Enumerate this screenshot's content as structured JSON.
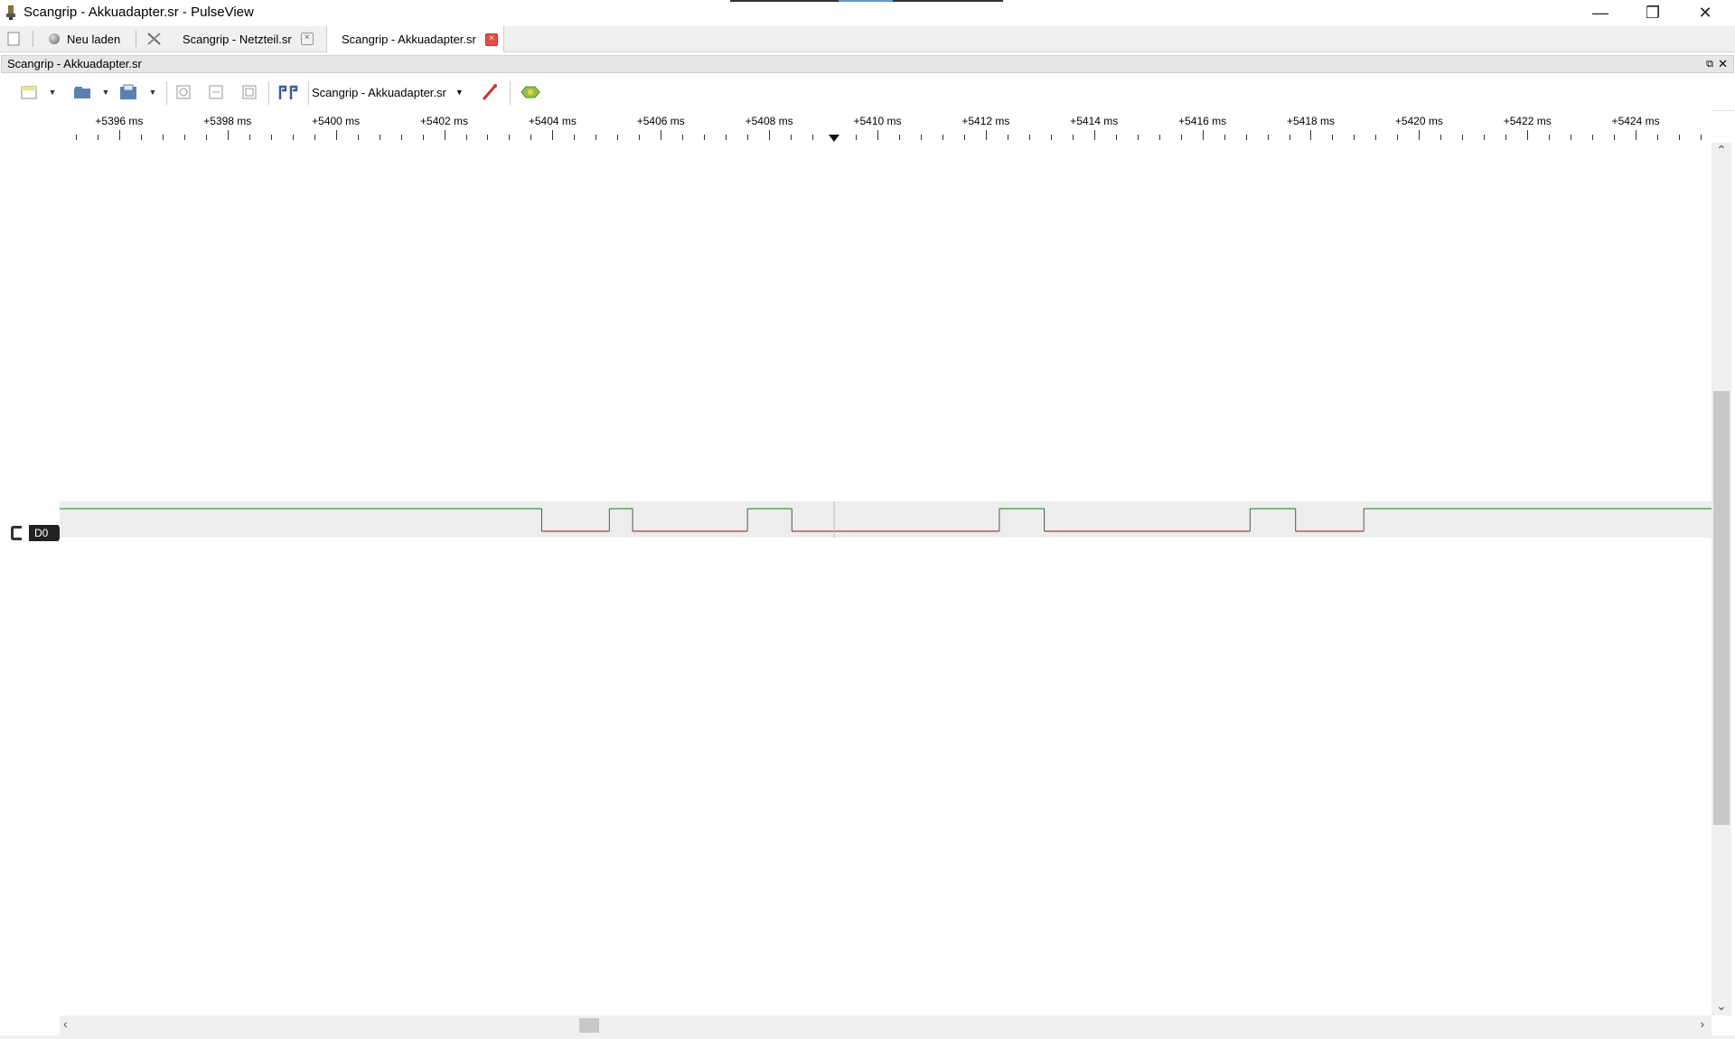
{
  "window": {
    "title": "Scangrip - Akkuadapter.sr - PulseView"
  },
  "tabbar": {
    "reload_label": "Neu laden",
    "tabs": [
      {
        "label": "Scangrip - Netzteil.sr",
        "active": false
      },
      {
        "label": "Scangrip - Akkuadapter.sr",
        "active": true
      }
    ]
  },
  "dock": {
    "title": "Scangrip - Akkuadapter.sr"
  },
  "toolbar": {
    "device_label": "Scangrip - Akkuadapter.sr"
  },
  "ruler": {
    "unit": "ms",
    "labels": [
      "+5396 ms",
      "+5398 ms",
      "+5400 ms",
      "+5402 ms",
      "+5404 ms",
      "+5406 ms",
      "+5408 ms",
      "+5410 ms",
      "+5412 ms",
      "+5414 ms",
      "+5416 ms",
      "+5418 ms",
      "+5420 ms",
      "+5422 ms",
      "+5424 ms"
    ],
    "start_ms": 5394.9,
    "end_ms": 5425.4,
    "trigger_ms": 5409.2
  },
  "channel": {
    "name": "D0",
    "high_color": "#2e9e2e",
    "low_color": "#c0392b",
    "transitions_ms": [
      {
        "t": 5394.9,
        "level": 1
      },
      {
        "t": 5403.8,
        "level": 0
      },
      {
        "t": 5405.05,
        "level": 1
      },
      {
        "t": 5405.48,
        "level": 0
      },
      {
        "t": 5407.6,
        "level": 1
      },
      {
        "t": 5408.42,
        "level": 0
      },
      {
        "t": 5412.25,
        "level": 1
      },
      {
        "t": 5413.08,
        "level": 0
      },
      {
        "t": 5416.88,
        "level": 1
      },
      {
        "t": 5417.72,
        "level": 0
      },
      {
        "t": 5418.98,
        "level": 1
      }
    ]
  },
  "icons": {
    "new": "new-session-icon",
    "open": "open-file-icon",
    "save": "save-icon",
    "zoom_in": "zoom-in-icon",
    "zoom_out": "zoom-out-icon",
    "zoom_fit": "zoom-fit-icon",
    "cursor": "cursor-icon",
    "probe": "probe-icon",
    "decoder": "decoder-icon"
  }
}
